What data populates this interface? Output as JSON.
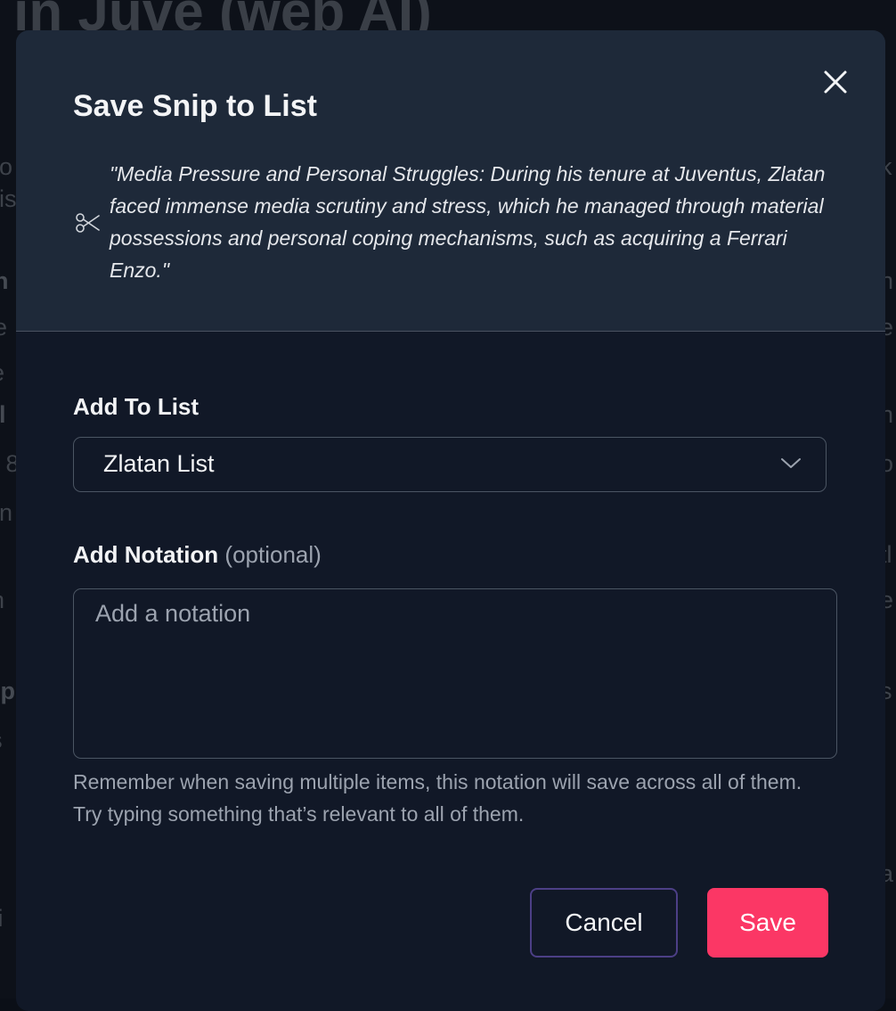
{
  "background": {
    "title_fragment": "n in Juve (web AI)",
    "left_fragments": [
      "no",
      "his",
      "th",
      "re",
      "le",
      "yl",
      "n 8",
      "on",
      "o",
      "in",
      "2",
      "np",
      "'s",
      "e",
      "e",
      "yi"
    ],
    "right_fragments": [
      "k",
      "h",
      "e",
      "n",
      "o",
      "tl",
      "e",
      "s",
      "a"
    ]
  },
  "modal": {
    "title": "Save Snip to List",
    "close_icon": "close-icon",
    "snip_icon": "scissors-icon",
    "quote": "\"Media Pressure and Personal Struggles: During his tenure at Juventus, Zlatan faced immense media scrutiny and stress, which he managed through material possessions and personal coping mechanisms, such as acquiring a Ferrari Enzo.\"",
    "list_section": {
      "label": "Add To List",
      "selected_value": "Zlatan List",
      "chevron_icon": "chevron-down-icon"
    },
    "notation_section": {
      "label": "Add Notation",
      "optional": "(optional)",
      "placeholder": "Add a notation",
      "value": "",
      "helper_text": "Remember when saving multiple items, this notation will save across all of them. Try typing something that’s relevant to all of them."
    },
    "buttons": {
      "cancel_label": "Cancel",
      "save_label": "Save"
    }
  },
  "colors": {
    "modal_background": "#111827",
    "header_background": "#1e2939",
    "save_accent": "#fb3765",
    "cancel_border": "#4c3f86"
  }
}
